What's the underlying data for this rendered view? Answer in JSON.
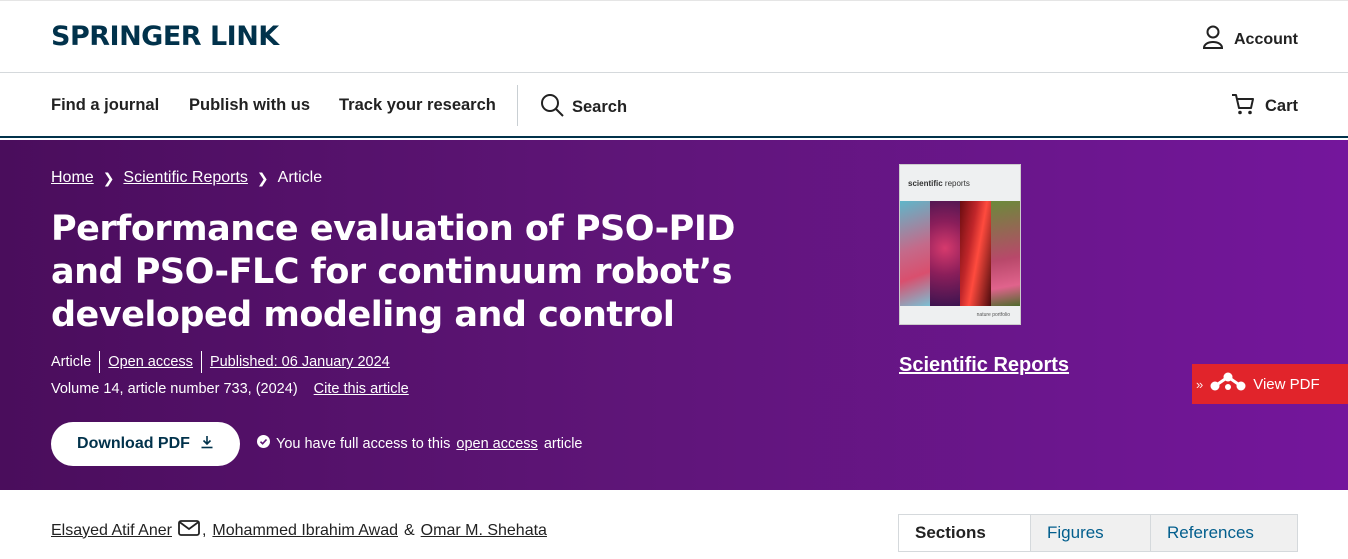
{
  "header": {
    "logo": "SPRINGER LINK",
    "account_label": "Account"
  },
  "nav": {
    "items": [
      "Find a journal",
      "Publish with us",
      "Track your research"
    ],
    "search_label": "Search",
    "cart_label": "Cart"
  },
  "breadcrumb": {
    "home": "Home",
    "journal": "Scientific Reports",
    "current": "Article"
  },
  "article": {
    "title": "Performance evaluation of PSO-PID and PSO-FLC for continuum robot’s developed modeling and control",
    "type": "Article",
    "access": "Open access",
    "published": "Published: 06 January 2024",
    "citation": "Volume 14, article number 733, (2024)",
    "cite_link": "Cite this article",
    "download_label": "Download PDF",
    "access_note_prefix": "You have full access to this",
    "access_note_link": "open access",
    "access_note_suffix": "article"
  },
  "journal": {
    "name": "Scientific Reports",
    "cover_title_bold": "scientific",
    "cover_title_rest": "reports",
    "cover_publisher": "nature portfolio"
  },
  "mendeley": {
    "label": "View PDF"
  },
  "authors": {
    "first": "Elsayed Atif Aner",
    "second": "Mohammed Ibrahim Awad",
    "separator_1": ",",
    "separator_2": "&",
    "third": "Omar M. Shehata"
  },
  "tabs": [
    "Sections",
    "Figures",
    "References"
  ],
  "colors": {
    "brand": "#01324b",
    "hero_start": "#4a0d5c",
    "hero_end": "#74169c",
    "link": "#025e8d",
    "mendeley": "#e1242b"
  }
}
